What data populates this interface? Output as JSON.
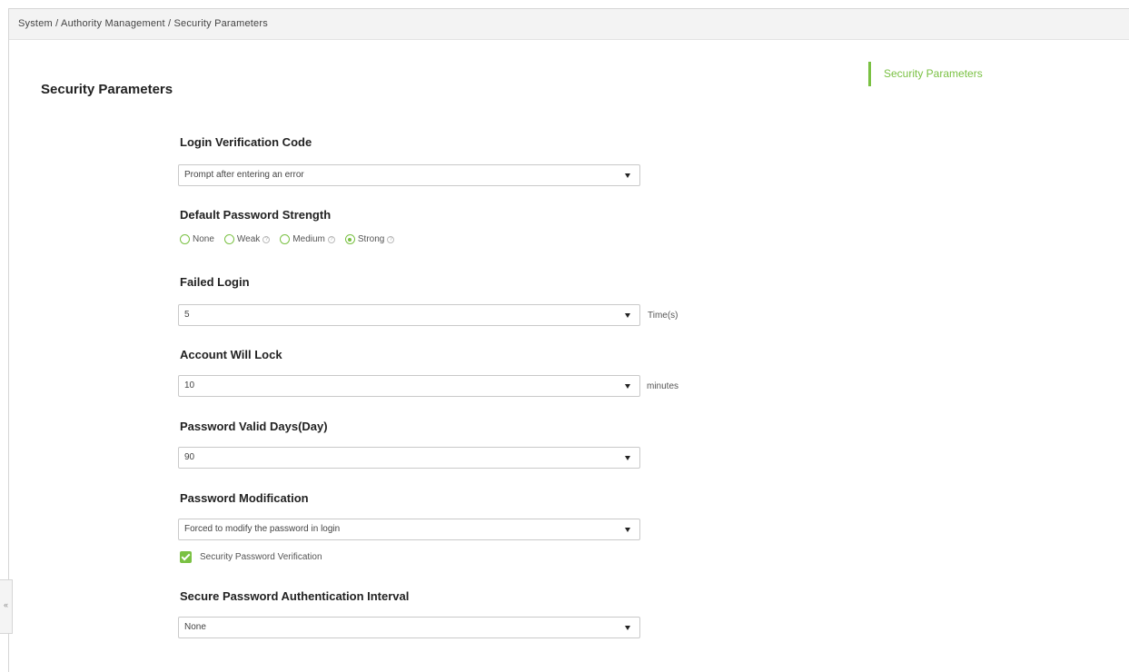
{
  "breadcrumb": "System / Authority Management / Security Parameters",
  "page_title": "Security Parameters",
  "side_nav": {
    "items": [
      "Security Parameters"
    ],
    "active_index": 0
  },
  "accent_color": "#7ac143",
  "form": {
    "login_verification_code": {
      "label": "Login Verification Code",
      "value": "Prompt after entering an error"
    },
    "default_password_strength": {
      "label": "Default Password Strength",
      "options": [
        "None",
        "Weak",
        "Medium",
        "Strong"
      ],
      "selected": "Strong"
    },
    "failed_login": {
      "label": "Failed Login",
      "value": "5",
      "unit": "Time(s)"
    },
    "account_will_lock": {
      "label": "Account Will Lock",
      "value": "10",
      "unit": "minutes"
    },
    "password_valid_days": {
      "label": "Password Valid Days(Day)",
      "value": "90"
    },
    "password_modification": {
      "label": "Password Modification",
      "value": "Forced to modify the password in login",
      "checkbox_label": "Security Password Verification",
      "checkbox_checked": true
    },
    "secure_password_interval": {
      "label": "Secure Password Authentication Interval",
      "value": "None"
    }
  },
  "icons": {
    "dropdown": "chevron-down-icon",
    "help": "help-circle-icon",
    "collapse": "collapse-left-icon"
  },
  "collapse_glyph": "«"
}
